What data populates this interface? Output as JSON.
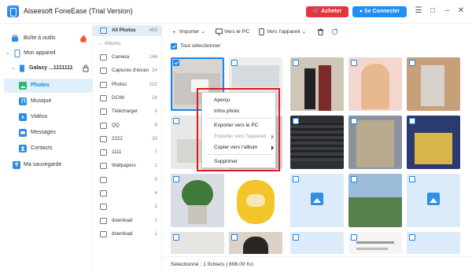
{
  "app": {
    "title": "Aiseesoft FoneEase (Trial Version)",
    "buy_label": "Acheter",
    "login_label": "Se Connecter"
  },
  "sidebar": {
    "items": [
      {
        "label": "Boîte à outils"
      },
      {
        "label": "Mon appareil"
      },
      {
        "label": "Galaxy ...1111111"
      },
      {
        "label": "Photos"
      },
      {
        "label": "Musique"
      },
      {
        "label": "Vidéos"
      },
      {
        "label": "Messages"
      },
      {
        "label": "Contacts"
      },
      {
        "label": "Ma sauvegarde"
      }
    ]
  },
  "albums": {
    "all_photos": {
      "label": "All Photos",
      "count": "463"
    },
    "section_label": "Albums",
    "items": [
      {
        "label": "Caméra",
        "count": "146"
      },
      {
        "label": "Captures d'écran",
        "count": "24"
      },
      {
        "label": "Photos",
        "count": "222"
      },
      {
        "label": "DCIM",
        "count": "18"
      },
      {
        "label": "Télécharger",
        "count": "0"
      },
      {
        "label": "QQ",
        "count": "9"
      },
      {
        "label": "2222",
        "count": "33"
      },
      {
        "label": "1111",
        "count": "7"
      },
      {
        "label": "Wallpapers",
        "count": "2"
      },
      {
        "label": "",
        "count": "3"
      },
      {
        "label": "",
        "count": "4"
      },
      {
        "label": "",
        "count": "2"
      },
      {
        "label": "download",
        "count": "1"
      },
      {
        "label": "download",
        "count": "1"
      }
    ]
  },
  "toolbar": {
    "import_label": "Importer",
    "to_pc_label": "Vers le PC",
    "to_device_label": "Vers l'appareil"
  },
  "select_all_label": "Tout sélectionner",
  "context_menu": {
    "items": [
      {
        "label": "Aperçu"
      },
      {
        "label": "Infos photo"
      },
      {
        "label": "Exporter vers le PC"
      },
      {
        "label": "Exporter vers l'appareil"
      },
      {
        "label": "Copier vers l'album"
      },
      {
        "label": "Supprimer"
      }
    ]
  },
  "status": {
    "text": "Sélectionné : 1 fichiers | 896.00 Ko"
  },
  "colors": {
    "accent": "#1a86e8",
    "buy": "#e5343c",
    "highlight_outline": "#e1171e",
    "sidebar_active_bg": "#dff0fb"
  }
}
